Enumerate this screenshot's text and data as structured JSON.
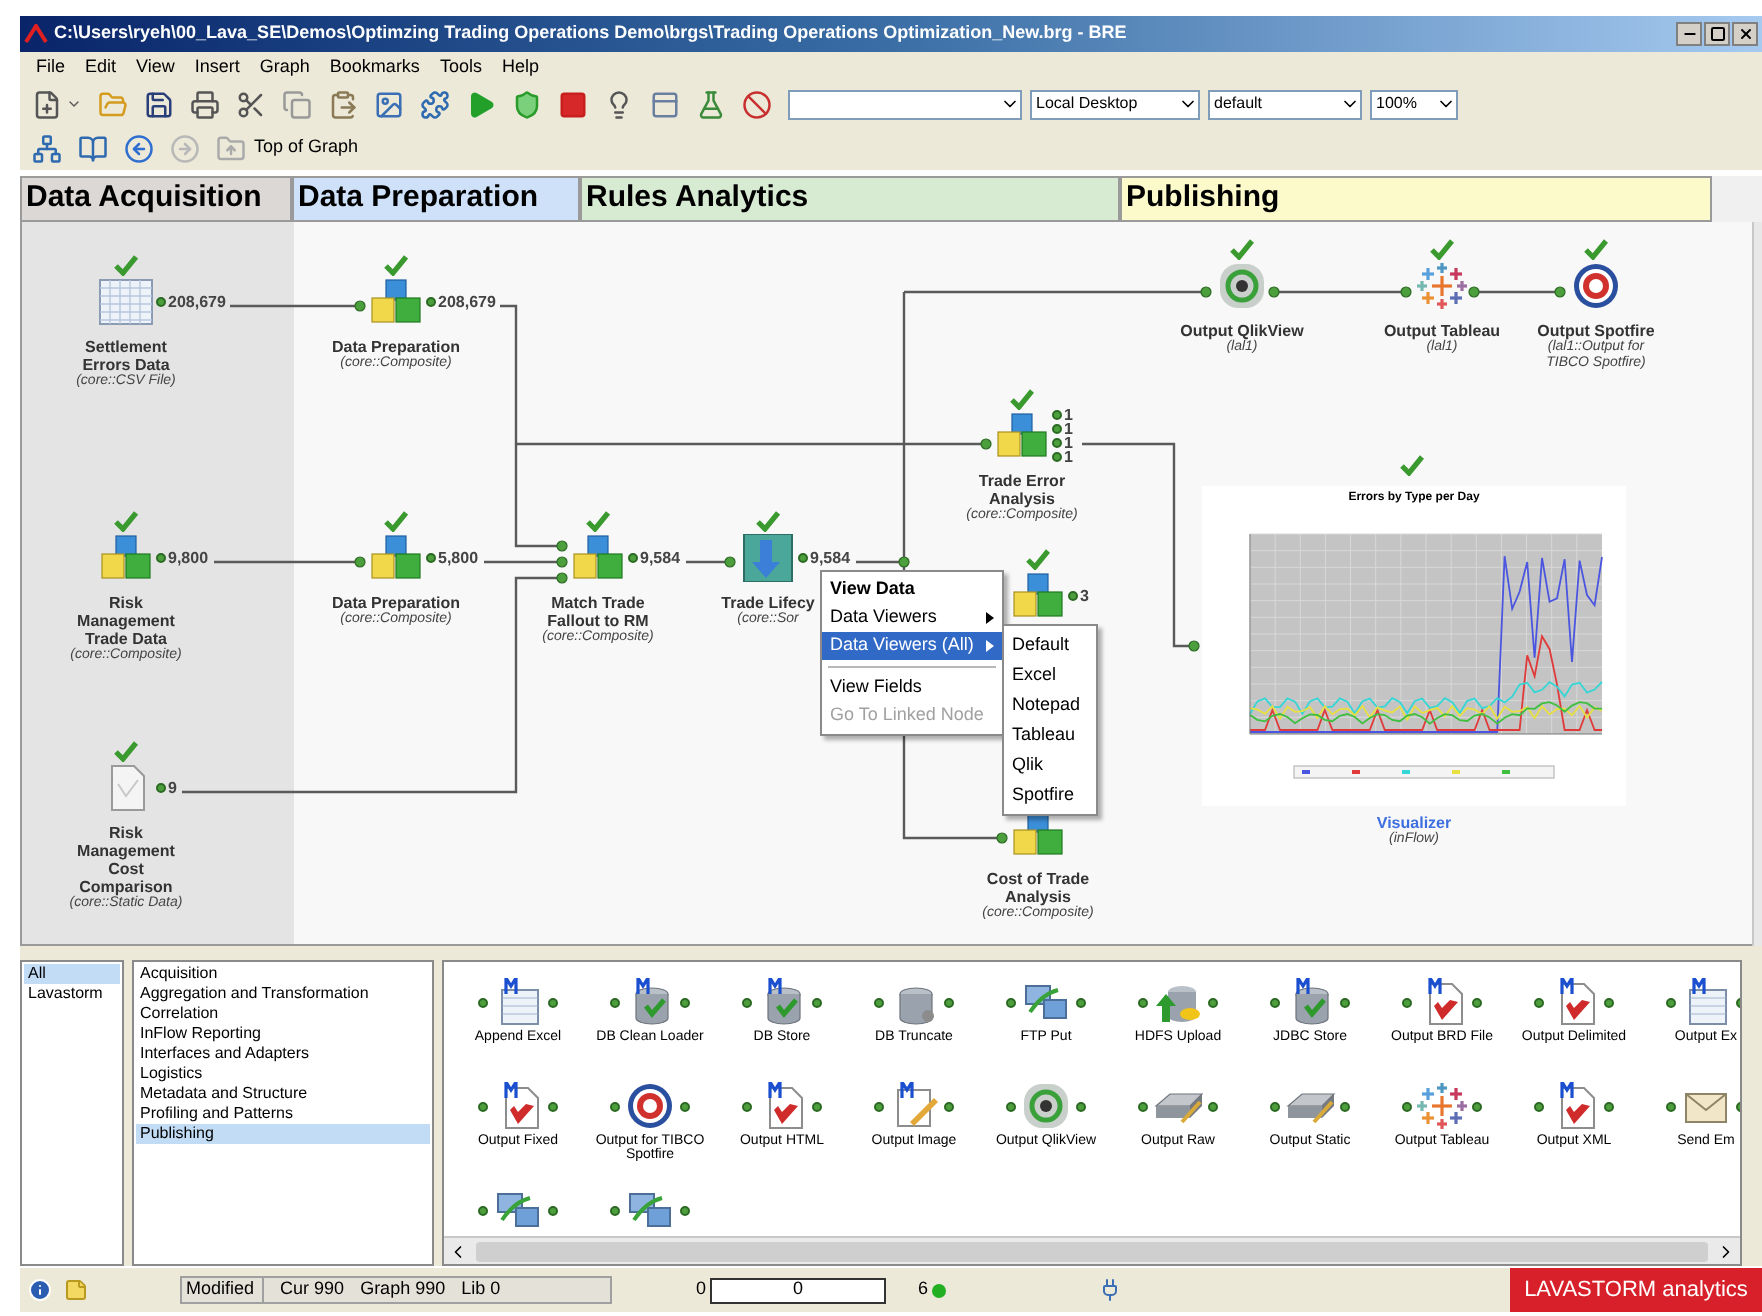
{
  "window": {
    "title": "C:\\Users\\ryeh\\00_Lava_SE\\Demos\\Optimzing Trading Operations Demo\\brgs\\Trading Operations Optimization_New.brg - BRE"
  },
  "menu": [
    "File",
    "Edit",
    "View",
    "Insert",
    "Graph",
    "Bookmarks",
    "Tools",
    "Help"
  ],
  "toolbar": {
    "combos": [
      "Local Desktop",
      "default",
      "100%"
    ]
  },
  "nav": {
    "label": "Top of Graph"
  },
  "sections": [
    {
      "label": "Data Acquisition",
      "color": "#dcd8d5"
    },
    {
      "label": "Data Preparation",
      "color": "#cfe1f8"
    },
    {
      "label": "Rules Analytics",
      "color": "#d7ebd3"
    },
    {
      "label": "Publishing",
      "color": "#fcfacb"
    }
  ],
  "nodes": [
    {
      "kind": "csv",
      "name": [
        "Settlement",
        "Errors Data"
      ],
      "type": [
        "(core::CSV File)"
      ],
      "counts": [
        "208,679"
      ],
      "done": true
    },
    {
      "kind": "composite",
      "name": [
        "Data Preparation"
      ],
      "type": [
        "(core::Composite)"
      ],
      "counts": [
        "208,679"
      ],
      "done": true
    },
    {
      "kind": "composite",
      "name": [
        "Risk",
        "Management",
        "Trade Data"
      ],
      "type": [
        "(core::Composite)"
      ],
      "counts": [
        "9,800"
      ],
      "done": true
    },
    {
      "kind": "composite",
      "name": [
        "Data Preparation"
      ],
      "type": [
        "(core::Composite)"
      ],
      "counts": [
        "5,800"
      ],
      "done": true
    },
    {
      "kind": "composite",
      "name": [
        "Match Trade",
        "Fallout to RM"
      ],
      "type": [
        "(core::Composite)"
      ],
      "counts": [
        "9,584"
      ],
      "done": true
    },
    {
      "kind": "sort",
      "name": [
        "Trade Lifecy"
      ],
      "type": [
        "(core::Sor"
      ],
      "counts": [
        "9,584"
      ],
      "done": true
    },
    {
      "kind": "static",
      "name": [
        "Risk",
        "Management",
        "Cost",
        "Comparison"
      ],
      "type": [
        "(core::Static Data)"
      ],
      "counts": [
        "9"
      ],
      "done": true
    },
    {
      "kind": "composite",
      "name": [
        "Trade Error",
        "Analysis"
      ],
      "type": [
        "(core::Composite)"
      ],
      "counts": [
        "1",
        "1",
        "1",
        "1"
      ],
      "done": true
    },
    {
      "kind": "composite",
      "counts": [
        "3"
      ],
      "done": true
    },
    {
      "kind": "composite",
      "name": [
        "Cost of Trade",
        "Analysis"
      ],
      "type": [
        "(core::Composite)"
      ]
    },
    {
      "kind": "qlik",
      "name": [
        "Output QlikView"
      ],
      "type": [
        "(lal1)"
      ],
      "done": true
    },
    {
      "kind": "tableau",
      "name": [
        "Output Tableau"
      ],
      "type": [
        "(lal1)"
      ],
      "done": true
    },
    {
      "kind": "spotfire",
      "name": [
        "Output Spotfire"
      ],
      "type": [
        "(lal1::Output for",
        "TIBCO Spotfire)"
      ],
      "done": true
    }
  ],
  "visualizer": {
    "title": "Errors by Type per Day",
    "name": "Visualizer",
    "type": "(inFlow)",
    "done": true
  },
  "context_menu": {
    "items": [
      {
        "kind": "item",
        "label": "View Data",
        "bold": true,
        "selected": false,
        "disabled": false
      },
      {
        "kind": "submenu",
        "label": "Data Viewers",
        "bold": false,
        "selected": false,
        "disabled": false
      },
      {
        "kind": "submenu",
        "label": "Data Viewers (All)",
        "bold": false,
        "selected": true,
        "disabled": false
      },
      {
        "kind": "separator"
      },
      {
        "kind": "item",
        "label": "View Fields",
        "bold": false,
        "selected": false,
        "disabled": false
      },
      {
        "kind": "item",
        "label": "Go To Linked Node",
        "bold": false,
        "selected": false,
        "disabled": true
      }
    ]
  },
  "submenu": [
    "Default",
    "Excel",
    "Notepad",
    "Tableau",
    "Qlik",
    "Spotfire"
  ],
  "palette": {
    "libraries": [
      {
        "label": "All",
        "selected": true
      },
      {
        "label": "Lavastorm",
        "selected": false
      }
    ],
    "categories": [
      {
        "label": "Acquisition",
        "selected": false
      },
      {
        "label": "Aggregation and Transformation",
        "selected": false
      },
      {
        "label": "Correlation",
        "selected": false
      },
      {
        "label": "InFlow Reporting",
        "selected": false
      },
      {
        "label": "Interfaces and Adapters",
        "selected": false
      },
      {
        "label": "Logistics",
        "selected": false
      },
      {
        "label": "Metadata and Structure",
        "selected": false
      },
      {
        "label": "Profiling and Patterns",
        "selected": false
      },
      {
        "label": "Publishing",
        "selected": true
      }
    ],
    "nodes": [
      {
        "kind": "sheet",
        "label": "Append Excel"
      },
      {
        "kind": "dbm",
        "label": "DB Clean Loader"
      },
      {
        "kind": "dbm",
        "label": "DB Store"
      },
      {
        "kind": "db",
        "label": "DB Truncate"
      },
      {
        "kind": "ftp",
        "label": "FTP Put"
      },
      {
        "kind": "hdfs",
        "label": "HDFS Upload"
      },
      {
        "kind": "dbm",
        "label": "JDBC Store"
      },
      {
        "kind": "docm",
        "label": "Output BRD File"
      },
      {
        "kind": "docm",
        "label": "Output Delimited"
      },
      {
        "kind": "sheet",
        "label": "Output Ex"
      },
      {
        "kind": "docm",
        "label": "Output Fixed"
      },
      {
        "kind": "spotfire",
        "label": "Output for TIBCO Spotfire"
      },
      {
        "kind": "docm",
        "label": "Output HTML"
      },
      {
        "kind": "image",
        "label": "Output Image"
      },
      {
        "kind": "qlik",
        "label": "Output QlikView"
      },
      {
        "kind": "drive",
        "label": "Output Raw"
      },
      {
        "kind": "drive",
        "label": "Output Static"
      },
      {
        "kind": "tableau",
        "label": "Output Tableau"
      },
      {
        "kind": "docm",
        "label": "Output XML"
      },
      {
        "kind": "mail",
        "label": "Send Em"
      },
      {
        "kind": "ftp"
      },
      {
        "kind": "ftp"
      }
    ]
  },
  "status_bar": {
    "state": "Modified",
    "cur": "Cur 990",
    "graph": "Graph 990",
    "lib": "Lib 0",
    "progress_start": "0",
    "progress_value": "0",
    "count": "6",
    "brand": "LAVASTORM analytics"
  }
}
